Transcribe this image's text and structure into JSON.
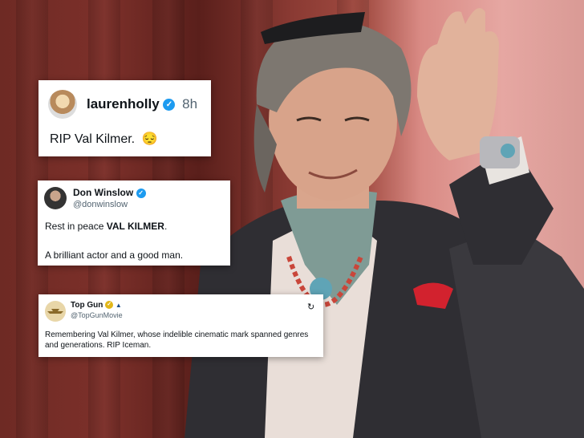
{
  "tweets": [
    {
      "username": "laurenholly",
      "time": "8h",
      "text": "RIP Val Kilmer.",
      "emoji": "😔"
    },
    {
      "display_name": "Don Winslow",
      "handle": "@donwinslow",
      "text_prefix": "Rest in peace ",
      "text_bold": "VAL KILMER",
      "text_suffix": ".",
      "text_line2": "A brilliant actor and a good man."
    },
    {
      "display_name": "Top Gun",
      "handle": "@TopGunMovie",
      "text": "Remembering Val Kilmer, whose indelible cinematic mark spanned genres and generations. RIP Iceman."
    }
  ],
  "colors": {
    "verified_blue": "#1d9bf0",
    "gold_badge": "#e2b719",
    "background_left": "#6e2a24",
    "background_right": "#e6a7a2"
  },
  "icons": [
    "verified-badge-icon",
    "gold-verified-badge-icon",
    "affiliate-badge-icon",
    "refresh-icon"
  ]
}
